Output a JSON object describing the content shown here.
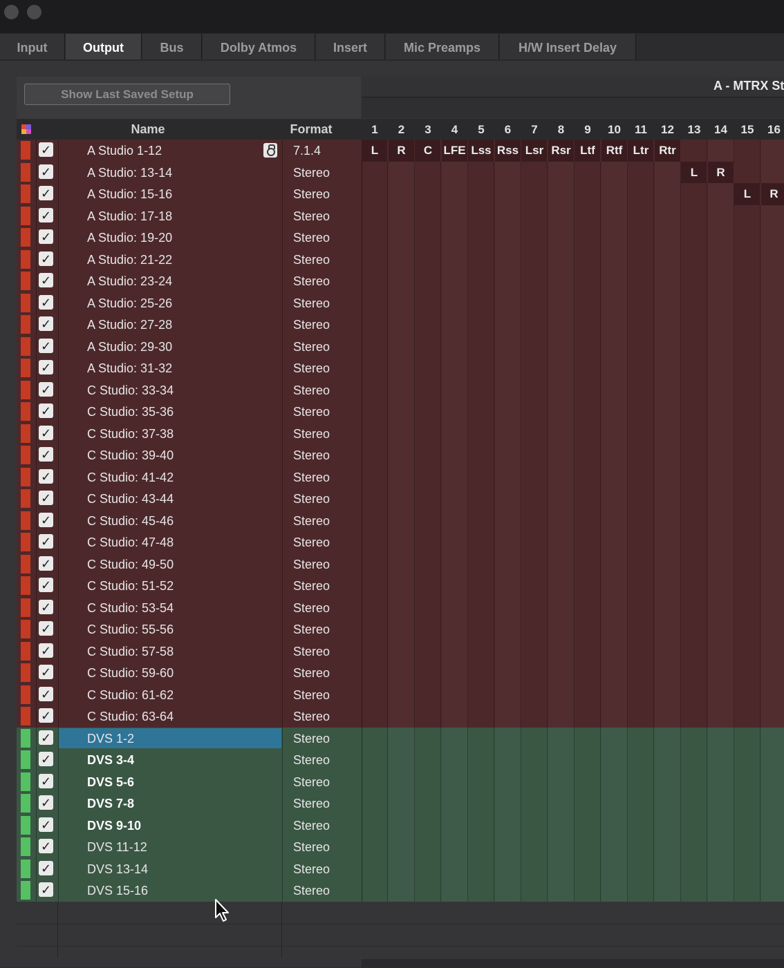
{
  "window": {
    "traffic_lights": [
      "close-button",
      "minimize-button"
    ]
  },
  "tabs": [
    {
      "label": "Input",
      "active": false
    },
    {
      "label": "Output",
      "active": true
    },
    {
      "label": "Bus",
      "active": false
    },
    {
      "label": "Dolby Atmos",
      "active": false
    },
    {
      "label": "Insert",
      "active": false
    },
    {
      "label": "Mic Preamps",
      "active": false
    },
    {
      "label": "H/W Insert Delay",
      "active": false
    }
  ],
  "toolbar": {
    "show_last_saved_label": "Show Last Saved Setup"
  },
  "device": {
    "title": "A - MTRX St"
  },
  "table": {
    "headers": {
      "name": "Name",
      "format": "Format"
    },
    "channel_numbers": [
      "1",
      "2",
      "3",
      "4",
      "5",
      "6",
      "7",
      "8",
      "9",
      "10",
      "11",
      "12",
      "13",
      "14",
      "15",
      "16"
    ],
    "colors": {
      "red_group": "#c43a22",
      "green_group": "#55c162",
      "selected": "#2e7598"
    },
    "rows": [
      {
        "name": "A Studio 1-12",
        "format": "7.1.4",
        "group": "red",
        "locked": true,
        "assignments": {
          "1": "L",
          "2": "R",
          "3": "C",
          "4": "LFE",
          "5": "Lss",
          "6": "Rss",
          "7": "Lsr",
          "8": "Rsr",
          "9": "Ltf",
          "10": "Rtf",
          "11": "Ltr",
          "12": "Rtr"
        }
      },
      {
        "name": "A Studio: 13-14",
        "format": "Stereo",
        "group": "red",
        "assignments": {
          "13": "L",
          "14": "R"
        }
      },
      {
        "name": "A Studio: 15-16",
        "format": "Stereo",
        "group": "red",
        "assignments": {
          "15": "L",
          "16": "R"
        }
      },
      {
        "name": "A Studio: 17-18",
        "format": "Stereo",
        "group": "red"
      },
      {
        "name": "A Studio: 19-20",
        "format": "Stereo",
        "group": "red"
      },
      {
        "name": "A Studio: 21-22",
        "format": "Stereo",
        "group": "red"
      },
      {
        "name": "A Studio: 23-24",
        "format": "Stereo",
        "group": "red"
      },
      {
        "name": "A Studio: 25-26",
        "format": "Stereo",
        "group": "red"
      },
      {
        "name": "A Studio: 27-28",
        "format": "Stereo",
        "group": "red"
      },
      {
        "name": "A Studio: 29-30",
        "format": "Stereo",
        "group": "red"
      },
      {
        "name": "A Studio: 31-32",
        "format": "Stereo",
        "group": "red"
      },
      {
        "name": "C Studio: 33-34",
        "format": "Stereo",
        "group": "red"
      },
      {
        "name": "C Studio: 35-36",
        "format": "Stereo",
        "group": "red"
      },
      {
        "name": "C Studio: 37-38",
        "format": "Stereo",
        "group": "red"
      },
      {
        "name": "C Studio: 39-40",
        "format": "Stereo",
        "group": "red"
      },
      {
        "name": "C Studio: 41-42",
        "format": "Stereo",
        "group": "red"
      },
      {
        "name": "C Studio: 43-44",
        "format": "Stereo",
        "group": "red"
      },
      {
        "name": "C Studio: 45-46",
        "format": "Stereo",
        "group": "red"
      },
      {
        "name": "C Studio: 47-48",
        "format": "Stereo",
        "group": "red"
      },
      {
        "name": "C Studio: 49-50",
        "format": "Stereo",
        "group": "red"
      },
      {
        "name": "C Studio: 51-52",
        "format": "Stereo",
        "group": "red"
      },
      {
        "name": "C Studio: 53-54",
        "format": "Stereo",
        "group": "red"
      },
      {
        "name": "C Studio: 55-56",
        "format": "Stereo",
        "group": "red"
      },
      {
        "name": "C Studio: 57-58",
        "format": "Stereo",
        "group": "red"
      },
      {
        "name": "C Studio: 59-60",
        "format": "Stereo",
        "group": "red"
      },
      {
        "name": "C Studio: 61-62",
        "format": "Stereo",
        "group": "red"
      },
      {
        "name": "C Studio: 63-64",
        "format": "Stereo",
        "group": "red"
      },
      {
        "name": "DVS 1-2",
        "format": "Stereo",
        "group": "green",
        "selected": true
      },
      {
        "name": "DVS 3-4",
        "format": "Stereo",
        "group": "green",
        "bold": true
      },
      {
        "name": "DVS 5-6",
        "format": "Stereo",
        "group": "green",
        "bold": true
      },
      {
        "name": "DVS 7-8",
        "format": "Stereo",
        "group": "green",
        "bold": true
      },
      {
        "name": "DVS 9-10",
        "format": "Stereo",
        "group": "green",
        "bold": true
      },
      {
        "name": "DVS 11-12",
        "format": "Stereo",
        "group": "green"
      },
      {
        "name": "DVS 13-14",
        "format": "Stereo",
        "group": "green"
      },
      {
        "name": "DVS 15-16",
        "format": "Stereo",
        "group": "green"
      }
    ]
  },
  "icons": {
    "check": "✓",
    "color-swatch": "color-swatch-icon",
    "lock": "lock-icon",
    "cursor": "mouse-pointer-icon"
  }
}
